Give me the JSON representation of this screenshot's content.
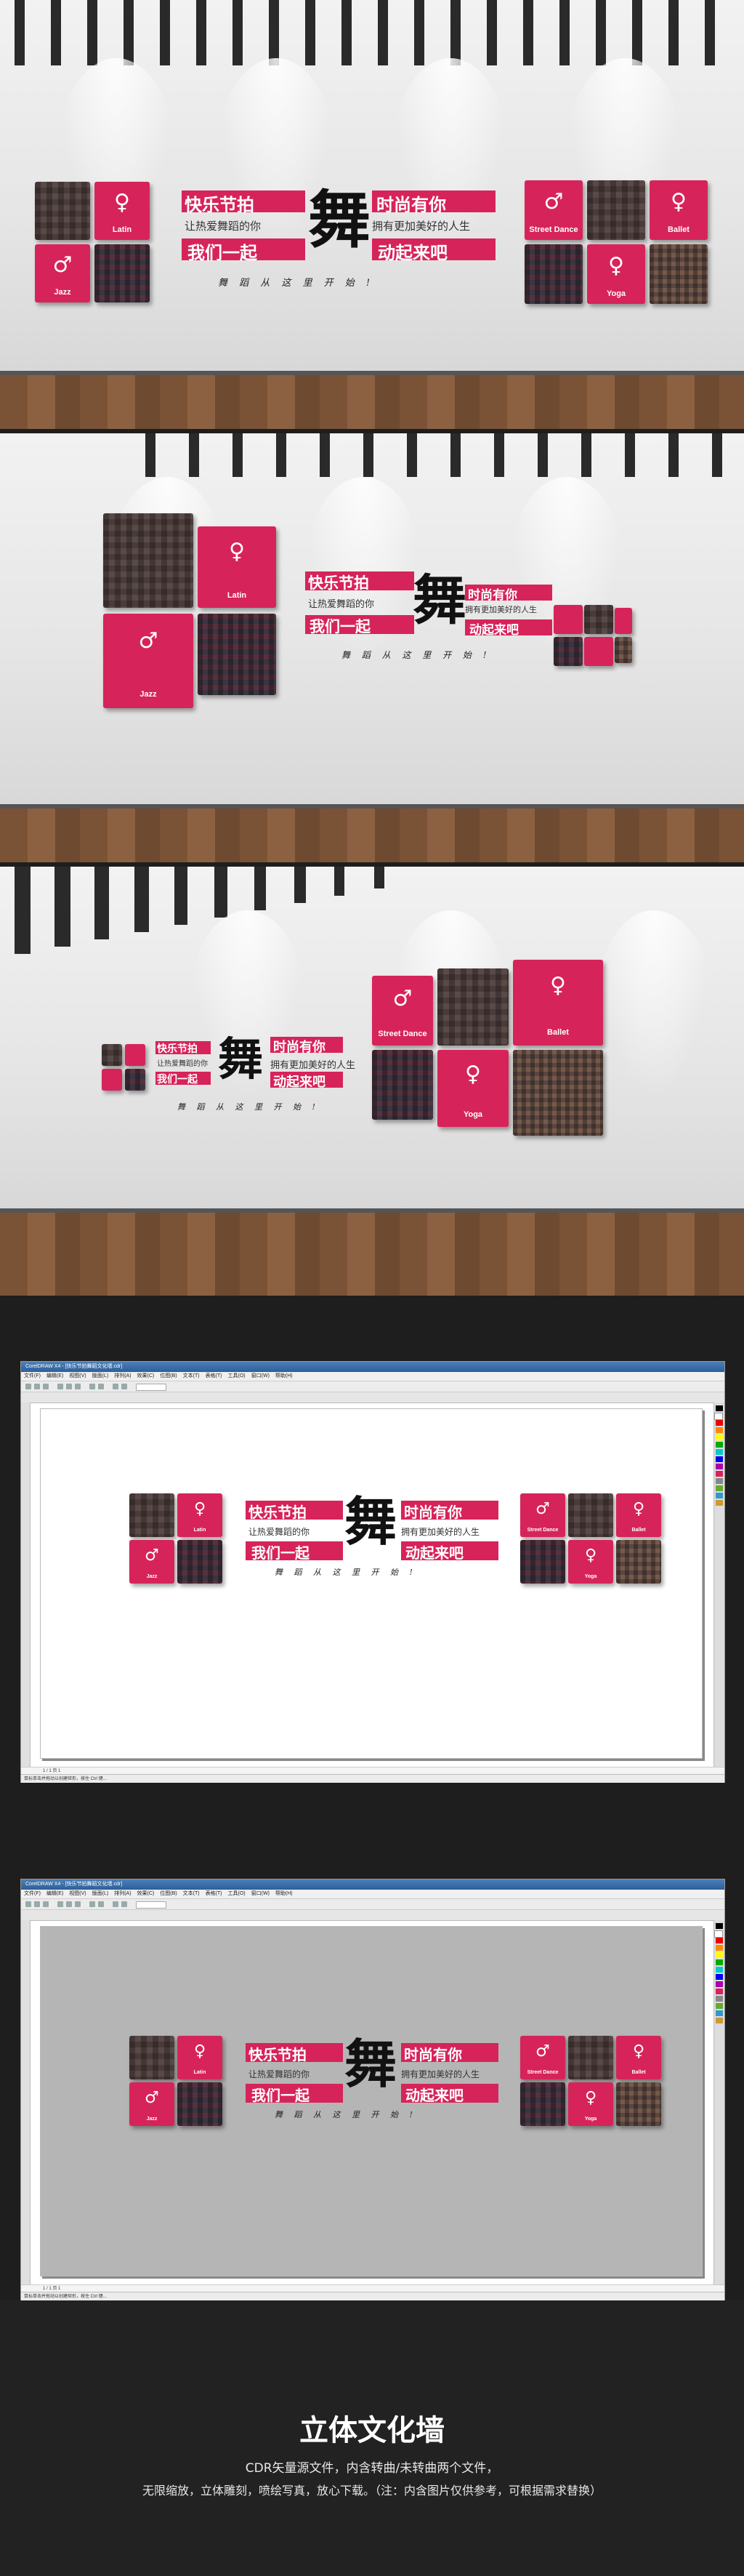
{
  "tiles": {
    "latin": "Latin",
    "jazz": "Jazz",
    "street_dance": "Street Dance",
    "ballet": "Ballet",
    "yoga": "Yoga"
  },
  "slogan": {
    "line1_left": "快乐节拍",
    "line1_right": "时尚有你",
    "line2_left": "让热爱舞蹈的你",
    "line2_right": "拥有更加美好的人生",
    "line3_left": "我们一起",
    "line3_right": "动起来吧",
    "calligraphy": "舞",
    "script_line": "舞 蹈 从 这 里 开 始 !"
  },
  "editor": {
    "title": "CorelDRAW X4 - [快乐节拍舞蹈文化墙.cdr]",
    "menu": [
      "文件(F)",
      "编辑(E)",
      "视图(V)",
      "版面(L)",
      "排列(A)",
      "效果(C)",
      "位图(B)",
      "文本(T)",
      "表格(T)",
      "工具(O)",
      "窗口(W)",
      "帮助(H)"
    ],
    "page_tab": "1 / 1   页 1",
    "status": "鼠标单击并拖动以创建矩形，按住 Ctrl 键..."
  },
  "footer": {
    "title": "立体文化墙",
    "line1": "CDR矢量源文件，内含转曲/未转曲两个文件，",
    "line2": "无限缩放，立体雕刻，喷绘写真，放心下载。（注：内含图片仅供参考，可根据需求替换）"
  }
}
